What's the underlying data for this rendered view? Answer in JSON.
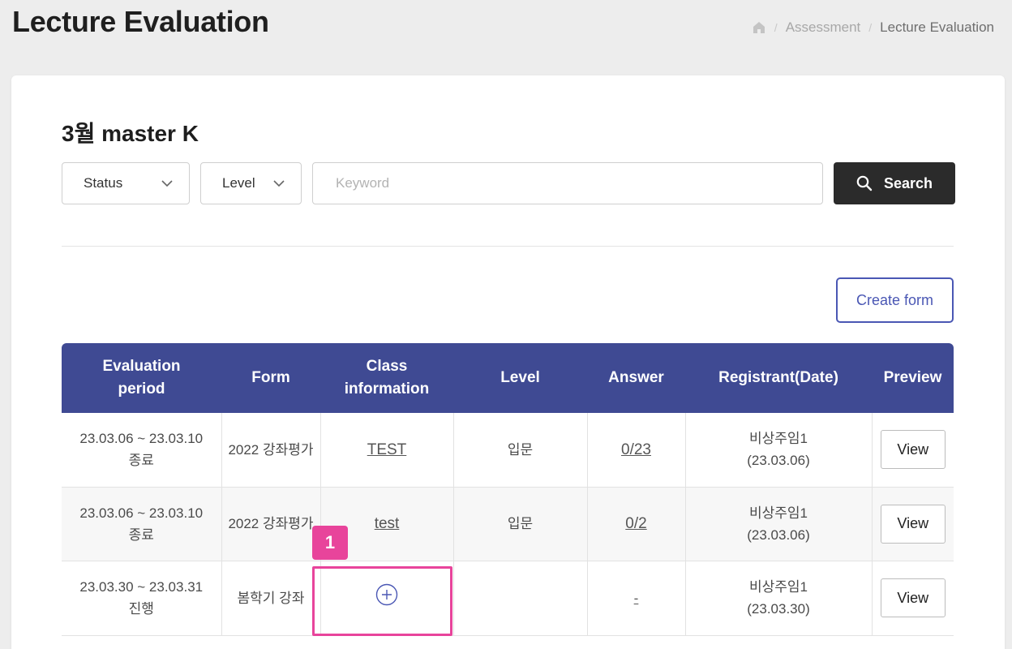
{
  "page": {
    "title": "Lecture Evaluation",
    "breadcrumb": [
      "Assessment",
      "Lecture Evaluation"
    ]
  },
  "course": {
    "title": "3월 master K"
  },
  "filters": {
    "status_label": "Status",
    "level_label": "Level",
    "keyword_placeholder": "Keyword",
    "search_label": "Search"
  },
  "create_form_label": "Create form",
  "table": {
    "headers": {
      "period": "Evaluation\nperiod",
      "form": "Form",
      "class_info": "Class\ninformation",
      "level": "Level",
      "answer": "Answer",
      "registrant": "Registrant(Date)",
      "preview": "Preview"
    },
    "rows": [
      {
        "period": "23.03.06 ~ 23.03.10",
        "status": "종료",
        "form": "2022 강좌평가",
        "class_info": "TEST",
        "level": "입문",
        "answer": "0/23",
        "registrant": "비상주임1",
        "date": "(23.03.06)",
        "preview": "View"
      },
      {
        "period": "23.03.06 ~ 23.03.10",
        "status": "종료",
        "form": "2022 강좌평가",
        "class_info": "test",
        "level": "입문",
        "answer": "0/2",
        "registrant": "비상주임1",
        "date": "(23.03.06)",
        "preview": "View"
      },
      {
        "period": "23.03.30 ~ 23.03.31",
        "status": "진행",
        "form": "봄학기 강좌",
        "class_info": "",
        "level": "",
        "answer": "-",
        "registrant": "비상주임1",
        "date": "(23.03.30)",
        "preview": "View"
      }
    ]
  },
  "annotation": {
    "badge": "1"
  },
  "colors": {
    "header_bg": "#3f4a93",
    "accent": "#4a57b4",
    "highlight": "#e8449b",
    "search_bg": "#2b2b2b"
  }
}
